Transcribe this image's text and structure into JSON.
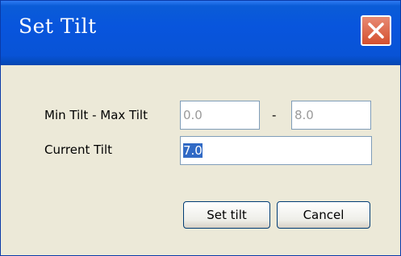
{
  "window": {
    "title": "Set Tilt"
  },
  "form": {
    "range_label": "Min Tilt - Max Tilt",
    "min_value": "0.0",
    "separator": "-",
    "max_value": "8.0",
    "current_label": "Current Tilt",
    "current_value": "7.0"
  },
  "buttons": {
    "set_label": "Set tilt",
    "cancel_label": "Cancel"
  }
}
